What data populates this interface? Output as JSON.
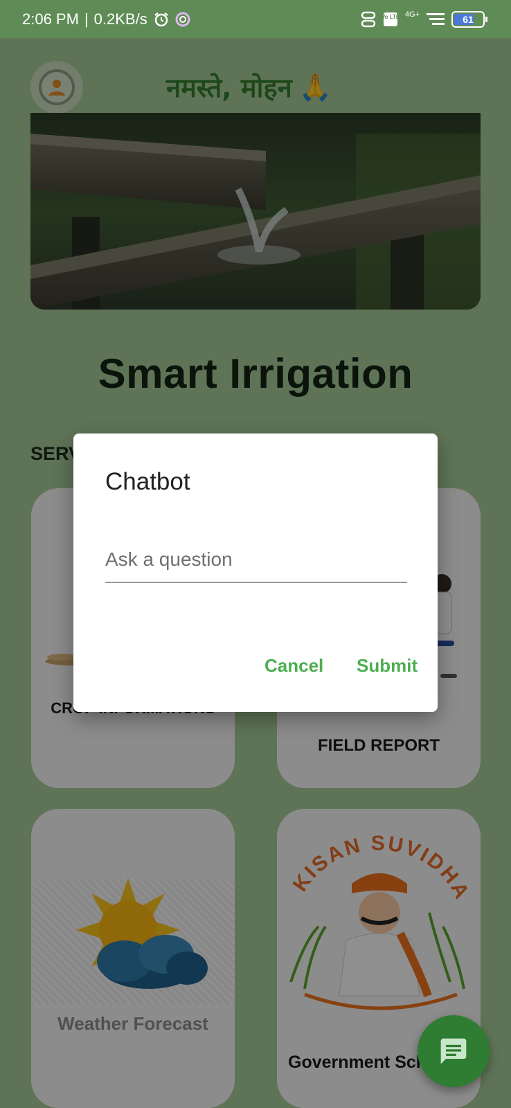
{
  "status_bar": {
    "time": "2:06 PM",
    "separator": "|",
    "speed": "0.2KB/s",
    "network": "4G+",
    "volte": "Vo LTE",
    "battery": "61"
  },
  "header": {
    "greeting": "नमस्ते, मोहन",
    "greeting_emoji": "🙏"
  },
  "app_title": "Smart Irrigation",
  "services_label": "SERVICES",
  "cards": [
    {
      "label": "CROP INFORMATIONS"
    },
    {
      "label": "FIELD REPORT"
    },
    {
      "label": "Weather Forecast"
    },
    {
      "label": "Government Schemes",
      "logo_text": "KISAN SUVIDHA"
    }
  ],
  "dialog": {
    "title": "Chatbot",
    "placeholder": "Ask a question",
    "cancel": "Cancel",
    "submit": "Submit"
  },
  "colors": {
    "accent": "#4caf50",
    "greeting": "#347b2e",
    "fab": "#2f7d32",
    "statusbar": "#5f8c56"
  },
  "icons": {
    "fab": "chat-icon",
    "avatar": "user-icon"
  }
}
